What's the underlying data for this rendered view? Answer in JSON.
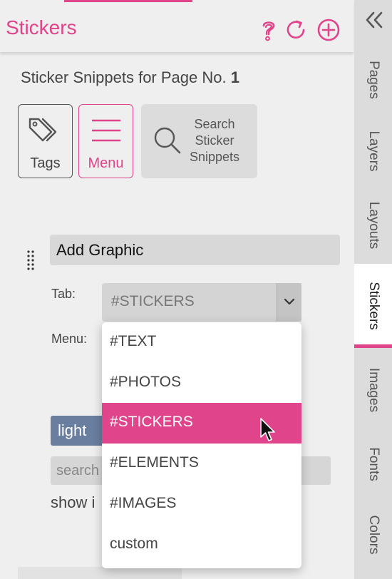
{
  "header": {
    "title": "Stickers",
    "icons": [
      "help-icon",
      "refresh-icon",
      "add-circle-icon"
    ]
  },
  "subtitle": {
    "text": "Sticker Snippets for Page No.",
    "page_number": "1"
  },
  "toolbar": {
    "tags_label": "Tags",
    "menu_label": "Menu",
    "search_label_lines": [
      "Search",
      "Sticker",
      "Snippets"
    ]
  },
  "graphic_row": {
    "name_value": "Add Graphic",
    "tab_label": "Tab:",
    "tab_value": "#STICKERS",
    "menu_label": "Menu:"
  },
  "dropdown": {
    "options": [
      {
        "label": "#TEXT",
        "selected": false
      },
      {
        "label": "#PHOTOS",
        "selected": false
      },
      {
        "label": "#STICKERS",
        "selected": true
      },
      {
        "label": "#ELEMENTS",
        "selected": false
      },
      {
        "label": "#IMAGES",
        "selected": false
      },
      {
        "label": "custom",
        "selected": false
      }
    ]
  },
  "background_content": {
    "tag_label": "light",
    "search_placeholder": "search",
    "show_text": "show i"
  },
  "right_panel": {
    "tabs": [
      {
        "label": "Pages",
        "active": false
      },
      {
        "label": "Layers",
        "active": false
      },
      {
        "label": "Layouts",
        "active": false
      },
      {
        "label": "Stickers",
        "active": true
      },
      {
        "label": "Images",
        "active": false
      },
      {
        "label": "Fonts",
        "active": false
      },
      {
        "label": "Colors",
        "active": false
      }
    ]
  },
  "colors": {
    "accent": "#e0448a",
    "tag_blue": "#6a7ea0",
    "panel_bg": "#efefef",
    "sidebar_bg": "#dcdcdc"
  }
}
